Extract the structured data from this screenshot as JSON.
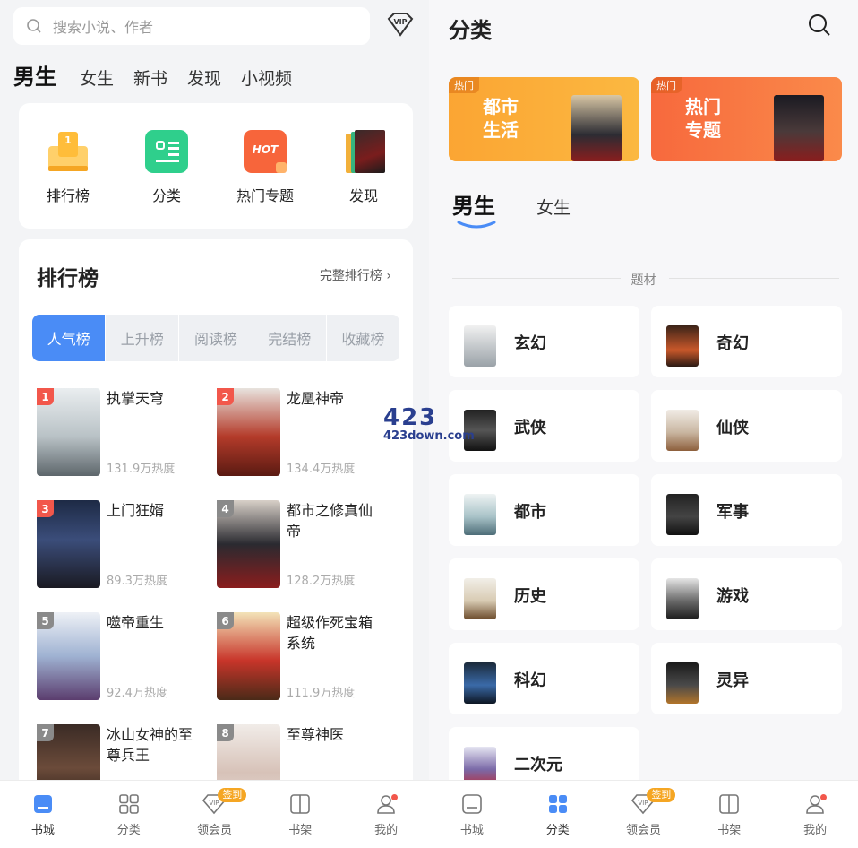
{
  "left": {
    "search": {
      "placeholder": "搜索小说、作者",
      "icon": "search-icon"
    },
    "vip_icon": "VIP",
    "tabs": [
      {
        "label": "男生",
        "active": true
      },
      {
        "label": "女生"
      },
      {
        "label": "新书"
      },
      {
        "label": "发现"
      },
      {
        "label": "小视频"
      }
    ],
    "entries": [
      {
        "label": "排行榜",
        "icon": "ranking-icon"
      },
      {
        "label": "分类",
        "icon": "category-icon"
      },
      {
        "label": "热门专题",
        "icon": "hot-topic-icon",
        "icon_text": "HOT"
      },
      {
        "label": "发现",
        "icon": "discover-books-icon"
      }
    ],
    "ranking": {
      "title": "排行榜",
      "more": "完整排行榜",
      "segments": [
        "人气榜",
        "上升榜",
        "阅读榜",
        "完结榜",
        "收藏榜"
      ],
      "active_segment": "人气榜",
      "books": [
        {
          "rank": "1",
          "title": "执掌天穹",
          "heat": "131.9万热度"
        },
        {
          "rank": "2",
          "title": "龙凰神帝",
          "heat": "134.4万热度"
        },
        {
          "rank": "3",
          "title": "上门狂婿",
          "heat": "89.3万热度"
        },
        {
          "rank": "4",
          "title": "都市之修真仙帝",
          "heat": "128.2万热度"
        },
        {
          "rank": "5",
          "title": "噬帝重生",
          "heat": "92.4万热度"
        },
        {
          "rank": "6",
          "title": "超级作死宝箱系统",
          "heat": "111.9万热度"
        },
        {
          "rank": "7",
          "title": "冰山女神的至尊兵王",
          "heat": ""
        },
        {
          "rank": "8",
          "title": "至尊神医",
          "heat": ""
        }
      ]
    },
    "nav": [
      {
        "label": "书城",
        "icon": "bookstore-icon",
        "active": true
      },
      {
        "label": "分类",
        "icon": "category-icon"
      },
      {
        "label": "领会员",
        "icon": "vip-icon",
        "badge": "签到"
      },
      {
        "label": "书架",
        "icon": "bookshelf-icon"
      },
      {
        "label": "我的",
        "icon": "profile-icon",
        "dot": true
      }
    ]
  },
  "right": {
    "title": "分类",
    "banners": [
      {
        "tag": "热门",
        "title": "都市生活",
        "color": "#f9a02a"
      },
      {
        "tag": "热门",
        "title": "热门专题",
        "color": "#f76b3c"
      }
    ],
    "gender_tabs": [
      {
        "label": "男生",
        "active": true
      },
      {
        "label": "女生"
      }
    ],
    "section_label": "题材",
    "categories": [
      "玄幻",
      "奇幻",
      "武侠",
      "仙侠",
      "都市",
      "军事",
      "历史",
      "游戏",
      "科幻",
      "灵异",
      "二次元"
    ],
    "nav": [
      {
        "label": "书城",
        "icon": "bookstore-icon"
      },
      {
        "label": "分类",
        "icon": "category-icon",
        "active": true
      },
      {
        "label": "领会员",
        "icon": "vip-icon",
        "badge": "签到"
      },
      {
        "label": "书架",
        "icon": "bookshelf-icon"
      },
      {
        "label": "我的",
        "icon": "profile-icon",
        "dot": true
      }
    ]
  },
  "watermark": {
    "line1": "423",
    "line2": "423down.com"
  },
  "colors": {
    "accent": "#4a8cf6",
    "rank_badge_top": "#f2574b",
    "rank_badge": "#888888",
    "orange": "#f9a02a"
  }
}
